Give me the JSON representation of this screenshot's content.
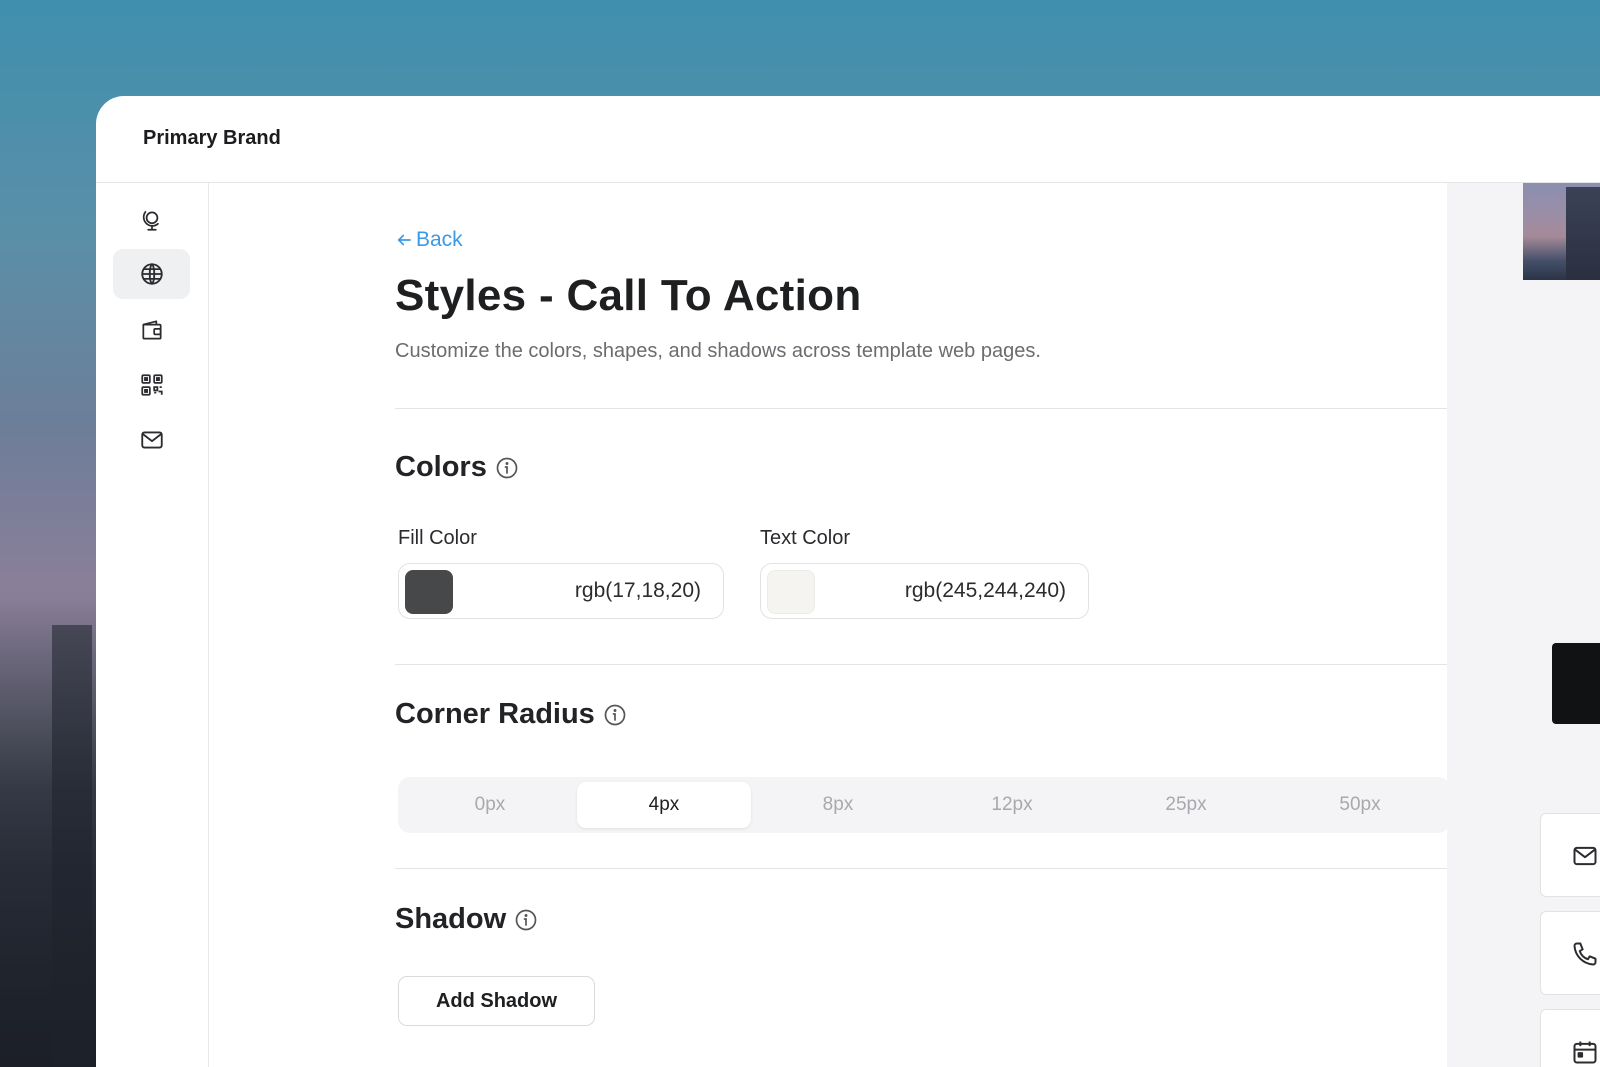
{
  "app": {
    "brand": "Primary Brand"
  },
  "sidebar": {
    "items": [
      {
        "icon": "globe-stand-icon",
        "active": false
      },
      {
        "icon": "globe-icon",
        "active": true
      },
      {
        "icon": "wallet-icon",
        "active": false
      },
      {
        "icon": "qr-code-icon",
        "active": false
      },
      {
        "icon": "mail-icon",
        "active": false
      }
    ]
  },
  "page": {
    "back_label": "Back",
    "title": "Styles - Call To Action",
    "subtitle": "Customize the colors, shapes, and shadows across template web pages."
  },
  "colors": {
    "title": "Colors",
    "fill": {
      "label": "Fill Color",
      "value": "rgb(17,18,20)",
      "swatch": "#474849"
    },
    "text": {
      "label": "Text Color",
      "value": "rgb(245,244,240)",
      "swatch": "#f5f4f0"
    }
  },
  "corner_radius": {
    "title": "Corner Radius",
    "options": [
      "0px",
      "4px",
      "8px",
      "12px",
      "25px",
      "50px"
    ],
    "selected": "4px"
  },
  "shadow": {
    "title": "Shadow",
    "add_label": "Add Shadow"
  },
  "theme": {
    "accent": "#3a9ae8",
    "cta_fill": "#111214"
  }
}
